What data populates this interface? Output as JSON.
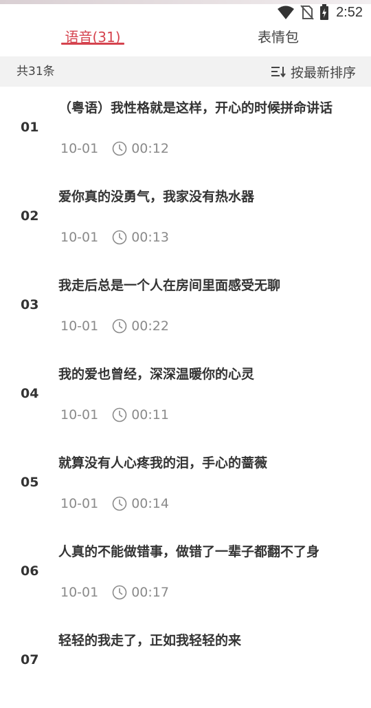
{
  "status_bar": {
    "time": "2:52",
    "icons": [
      "wifi-icon",
      "no-sim-icon",
      "battery-charging-icon"
    ]
  },
  "tabs": [
    {
      "label": "语音(31)",
      "active": true
    },
    {
      "label": "表情包",
      "active": false
    }
  ],
  "filter": {
    "count_label": "共31条",
    "sort_label": "按最新排序",
    "sort_icon": "sort-icon"
  },
  "colors": {
    "accent": "#d5434e",
    "filter_bg": "#f2f2f2",
    "meta_text": "#8a8a8a"
  },
  "items": [
    {
      "index": "01",
      "title": "（粤语）我性格就是这样，开心的时候拼命讲话",
      "date": "10-01",
      "duration": "00:12"
    },
    {
      "index": "02",
      "title": "爱你真的没勇气，我家没有热水器",
      "date": "10-01",
      "duration": "00:13"
    },
    {
      "index": "03",
      "title": "我走后总是一个人在房间里面感受无聊",
      "date": "10-01",
      "duration": "00:22"
    },
    {
      "index": "04",
      "title": "我的爱也曾经，深深温暖你的心灵",
      "date": "10-01",
      "duration": "00:11"
    },
    {
      "index": "05",
      "title": "就算没有人心疼我的泪，手心的蔷薇",
      "date": "10-01",
      "duration": "00:14"
    },
    {
      "index": "06",
      "title": "人真的不能做错事，做错了一辈子都翻不了身",
      "date": "10-01",
      "duration": "00:17"
    },
    {
      "index": "07",
      "title": "轻轻的我走了，正如我轻轻的来",
      "date": "",
      "duration": ""
    }
  ]
}
